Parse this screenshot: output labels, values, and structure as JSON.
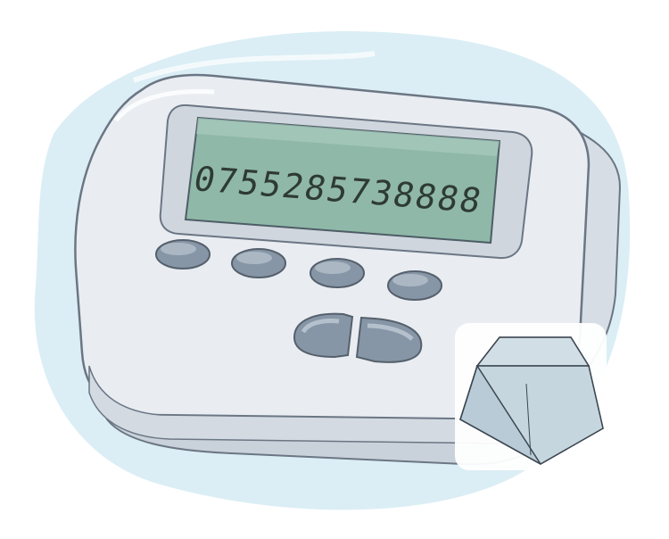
{
  "pager": {
    "display_number": "0755285738888"
  },
  "colors": {
    "background_blob": "#dbeef5",
    "casing": "#e9edf2",
    "casing_shadow": "#c9d1da",
    "outline": "#6b7684",
    "screen_bezel": "#cfd6de",
    "lcd": "#8fb8a8",
    "button": "#8796a6",
    "button_highlight": "#b4c0cc",
    "keycap": "#b8cbd6"
  },
  "icons": [
    "pager-illustration",
    "keycap-icon"
  ]
}
